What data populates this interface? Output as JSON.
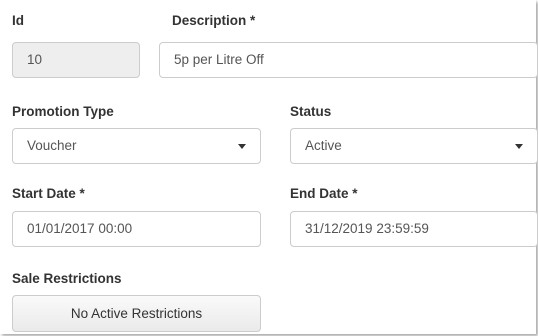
{
  "fields": {
    "id": {
      "label": "Id",
      "value": "10"
    },
    "description": {
      "label": "Description *",
      "value": "5p per Litre Off"
    },
    "promotion_type": {
      "label": "Promotion Type",
      "value": "Voucher"
    },
    "status": {
      "label": "Status",
      "value": "Active"
    },
    "start_date": {
      "label": "Start Date *",
      "value": "01/01/2017 00:00"
    },
    "end_date": {
      "label": "End Date *",
      "value": "31/12/2019 23:59:59"
    },
    "sale_restrictions": {
      "label": "Sale Restrictions",
      "button_label": "No Active Restrictions"
    }
  },
  "icons": {
    "dropdown": "chevron-down-icon"
  }
}
